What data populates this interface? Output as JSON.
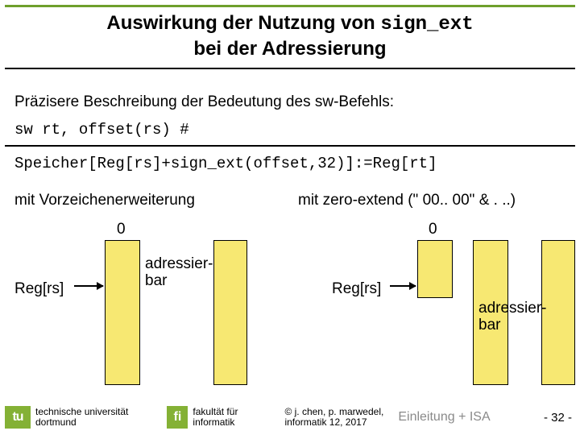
{
  "title": {
    "line1_prefix": "Auswirkung der Nutzung von ",
    "line1_mono": "sign_ext",
    "line2": "bei der Adressierung"
  },
  "description": "Präzisere Beschreibung der Bedeutung des sw-Befehls:",
  "code_line1": "sw rt, offset(rs) #",
  "code_line2": "Speicher[Reg[rs]+sign_ext(offset,32)]:=Reg[rt]",
  "left": {
    "caption": "mit Vorzeichenerweiterung",
    "zero": "0",
    "reg": "Reg[rs]",
    "addressable": "adressier-\nbar"
  },
  "right": {
    "caption": "mit zero-extend (\" 00.. 00\" & . ..)",
    "zero": "0",
    "reg": "Reg[rs]",
    "addressable": "adressier-\nbar"
  },
  "footer": {
    "tu_logo": "tu",
    "tu_text_line1": "technische universität",
    "tu_text_line2": "dortmund",
    "fi_logo": "fi",
    "fi_text_line1": "fakultät für",
    "fi_text_line2": "informatik",
    "copyright_line1": "© j. chen, p. marwedel,",
    "copyright_line2": "informatik 12, 2017",
    "lecture": "Einleitung + ISA",
    "pagenum": "- 32 -"
  }
}
